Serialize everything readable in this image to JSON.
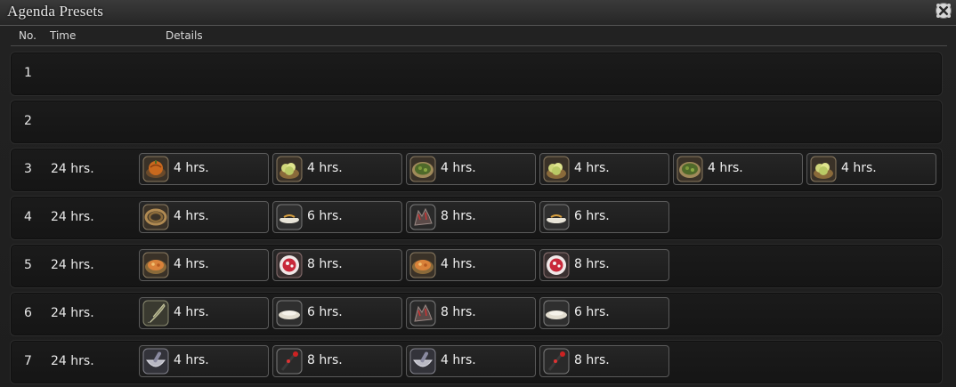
{
  "window": {
    "title": "Agenda Presets"
  },
  "header": {
    "no": "No.",
    "time": "Time",
    "details": "Details"
  },
  "rows": [
    {
      "no": "1",
      "time": "",
      "slots": []
    },
    {
      "no": "2",
      "time": "",
      "slots": []
    },
    {
      "no": "3",
      "time": "24 hrs.",
      "slots": [
        {
          "label": "4 hrs.",
          "icon": "pumpkin-dish-icon"
        },
        {
          "label": "4 hrs.",
          "icon": "salad-dish-icon"
        },
        {
          "label": "4 hrs.",
          "icon": "green-soup-icon"
        },
        {
          "label": "4 hrs.",
          "icon": "salad-dish-icon"
        },
        {
          "label": "4 hrs.",
          "icon": "green-soup-icon"
        },
        {
          "label": "4 hrs.",
          "icon": "salad-dish-icon"
        }
      ]
    },
    {
      "no": "4",
      "time": "24 hrs.",
      "slots": [
        {
          "label": "4 hrs.",
          "icon": "rope-coil-icon"
        },
        {
          "label": "6 hrs.",
          "icon": "sushi-icon"
        },
        {
          "label": "8 hrs.",
          "icon": "dragon-gauntlet-icon"
        },
        {
          "label": "6 hrs.",
          "icon": "sushi-icon"
        }
      ]
    },
    {
      "no": "5",
      "time": "24 hrs.",
      "slots": [
        {
          "label": "4 hrs.",
          "icon": "stew-bowl-icon"
        },
        {
          "label": "8 hrs.",
          "icon": "red-plate-icon"
        },
        {
          "label": "4 hrs.",
          "icon": "stew-bowl-icon"
        },
        {
          "label": "8 hrs.",
          "icon": "red-plate-icon"
        }
      ]
    },
    {
      "no": "6",
      "time": "24 hrs.",
      "slots": [
        {
          "label": "4 hrs.",
          "icon": "feather-pen-icon"
        },
        {
          "label": "6 hrs.",
          "icon": "white-dish-icon"
        },
        {
          "label": "8 hrs.",
          "icon": "dragon-gauntlet-icon"
        },
        {
          "label": "6 hrs.",
          "icon": "white-dish-icon"
        }
      ]
    },
    {
      "no": "7",
      "time": "24 hrs.",
      "slots": [
        {
          "label": "4 hrs.",
          "icon": "mortar-pestle-icon"
        },
        {
          "label": "8 hrs.",
          "icon": "red-staff-icon"
        },
        {
          "label": "4 hrs.",
          "icon": "mortar-pestle-icon"
        },
        {
          "label": "8 hrs.",
          "icon": "red-staff-icon"
        }
      ]
    }
  ]
}
